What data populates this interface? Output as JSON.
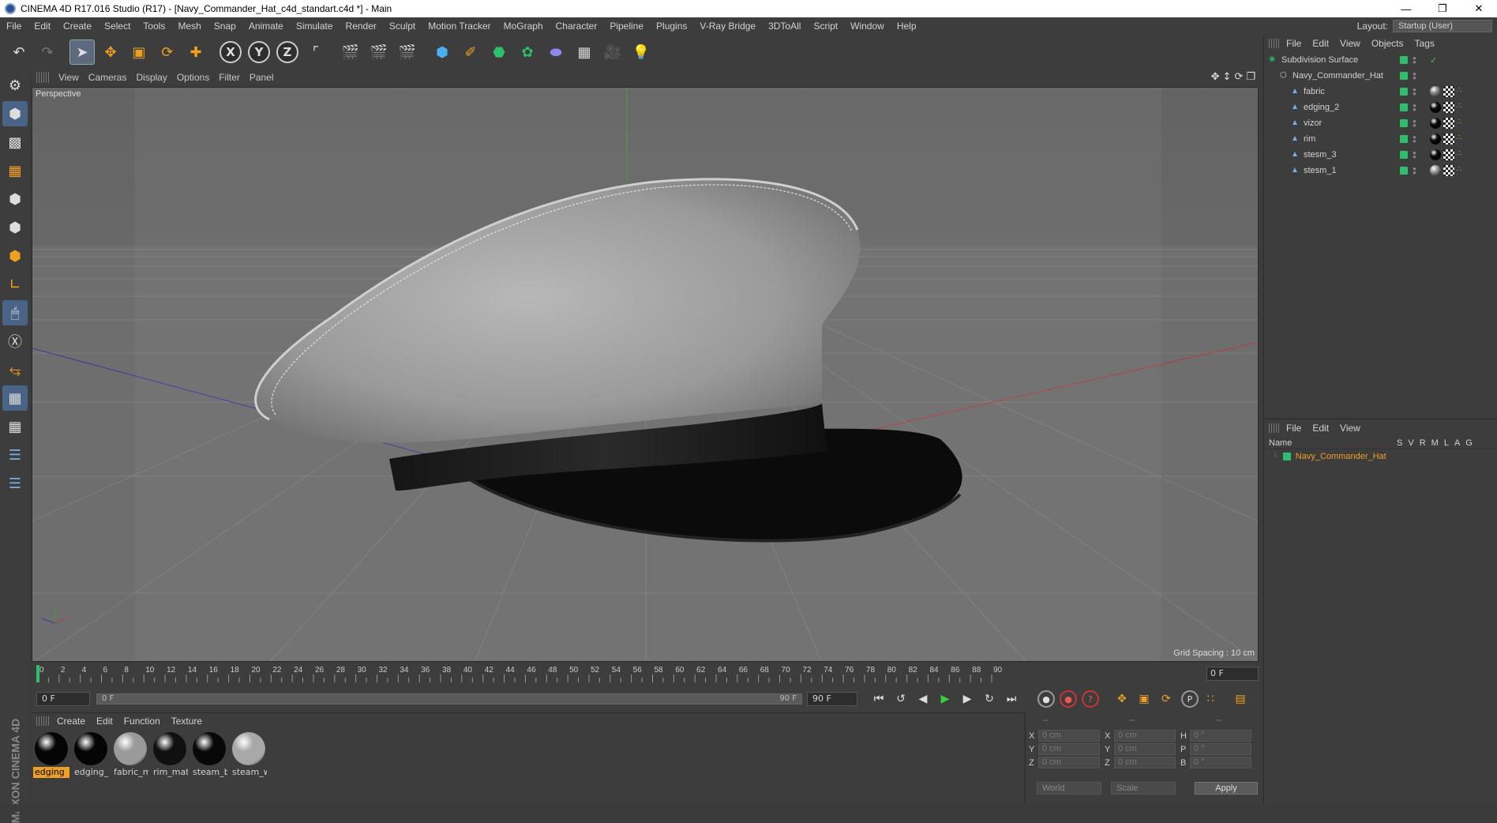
{
  "window": {
    "title": "CINEMA 4D R17.016 Studio (R17) - [Navy_Commander_Hat_c4d_standart.c4d *] - Main"
  },
  "menubar": {
    "items": [
      "File",
      "Edit",
      "Create",
      "Select",
      "Tools",
      "Mesh",
      "Snap",
      "Animate",
      "Simulate",
      "Render",
      "Sculpt",
      "Motion Tracker",
      "MoGraph",
      "Character",
      "Pipeline",
      "Plugins",
      "V-Ray Bridge",
      "3DToAll",
      "Script",
      "Window",
      "Help"
    ],
    "layout_label": "Layout:",
    "layout_value": "Startup (User)"
  },
  "viewport": {
    "menu": [
      "View",
      "Cameras",
      "Display",
      "Options",
      "Filter",
      "Panel"
    ],
    "camera_label": "Perspective",
    "grid_spacing": "Grid Spacing : 10 cm"
  },
  "timeline": {
    "ticks": [
      "0",
      "2",
      "4",
      "6",
      "8",
      "10",
      "12",
      "14",
      "16",
      "18",
      "20",
      "22",
      "24",
      "26",
      "28",
      "30",
      "32",
      "34",
      "36",
      "38",
      "40",
      "42",
      "44",
      "46",
      "48",
      "50",
      "52",
      "54",
      "56",
      "58",
      "60",
      "62",
      "64",
      "66",
      "68",
      "70",
      "72",
      "74",
      "76",
      "78",
      "80",
      "82",
      "84",
      "86",
      "88",
      "90"
    ],
    "current_frame": "0 F",
    "start_frame": "0 F",
    "slider_left": "0 F",
    "slider_right": "90 F",
    "end_frame": "90 F"
  },
  "materials": {
    "menu": [
      "Create",
      "Edit",
      "Function",
      "Texture"
    ],
    "items": [
      {
        "name": "edging",
        "selected": true,
        "color": "#050505"
      },
      {
        "name": "edging_",
        "selected": false,
        "color": "#050505"
      },
      {
        "name": "fabric_m",
        "selected": false,
        "color": "#9a9a9a"
      },
      {
        "name": "rim_mat",
        "selected": false,
        "color": "#101010"
      },
      {
        "name": "steam_b",
        "selected": false,
        "color": "#080808"
      },
      {
        "name": "steam_w",
        "selected": false,
        "color": "#a8a8a8"
      }
    ]
  },
  "coordinates": {
    "rows": [
      {
        "a": "X",
        "v1": "0 cm",
        "b": "X",
        "v2": "0 cm",
        "c": "H",
        "v3": "0 °"
      },
      {
        "a": "Y",
        "v1": "0 cm",
        "b": "Y",
        "v2": "0 cm",
        "c": "P",
        "v3": "0 °"
      },
      {
        "a": "Z",
        "v1": "0 cm",
        "b": "Z",
        "v2": "0 cm",
        "c": "B",
        "v3": "0 °"
      }
    ],
    "mode1": "World",
    "mode2": "Scale",
    "apply": "Apply",
    "head1": "--",
    "head2": "--",
    "head3": "--"
  },
  "object_manager": {
    "menu": [
      "File",
      "Edit",
      "View",
      "Objects",
      "Tags"
    ],
    "objects": [
      {
        "name": "Subdivision Surface",
        "indent": 0
      },
      {
        "name": "Navy_Commander_Hat",
        "indent": 1
      },
      {
        "name": "fabric",
        "indent": 2,
        "tag_color": "#8a8a8a"
      },
      {
        "name": "edging_2",
        "indent": 2,
        "tag_color": "#0a0a0a"
      },
      {
        "name": "vizor",
        "indent": 2,
        "tag_color": "#0a0a0a"
      },
      {
        "name": "rim",
        "indent": 2,
        "tag_color": "#0a0a0a"
      },
      {
        "name": "stesm_3",
        "indent": 2,
        "tag_color": "#0a0a0a"
      },
      {
        "name": "stesm_1",
        "indent": 2,
        "tag_color": "#9a9a9a"
      }
    ]
  },
  "attribute_manager": {
    "menu": [
      "File",
      "Edit",
      "View"
    ],
    "col_name": "Name",
    "cols": [
      "S",
      "V",
      "R",
      "M",
      "L",
      "A",
      "G"
    ],
    "row": "Navy_Commander_Hat"
  },
  "colors": {
    "accent": "#f0a020",
    "layer_green": "#2cc06a",
    "ui_bg": "#3d3d3d"
  }
}
